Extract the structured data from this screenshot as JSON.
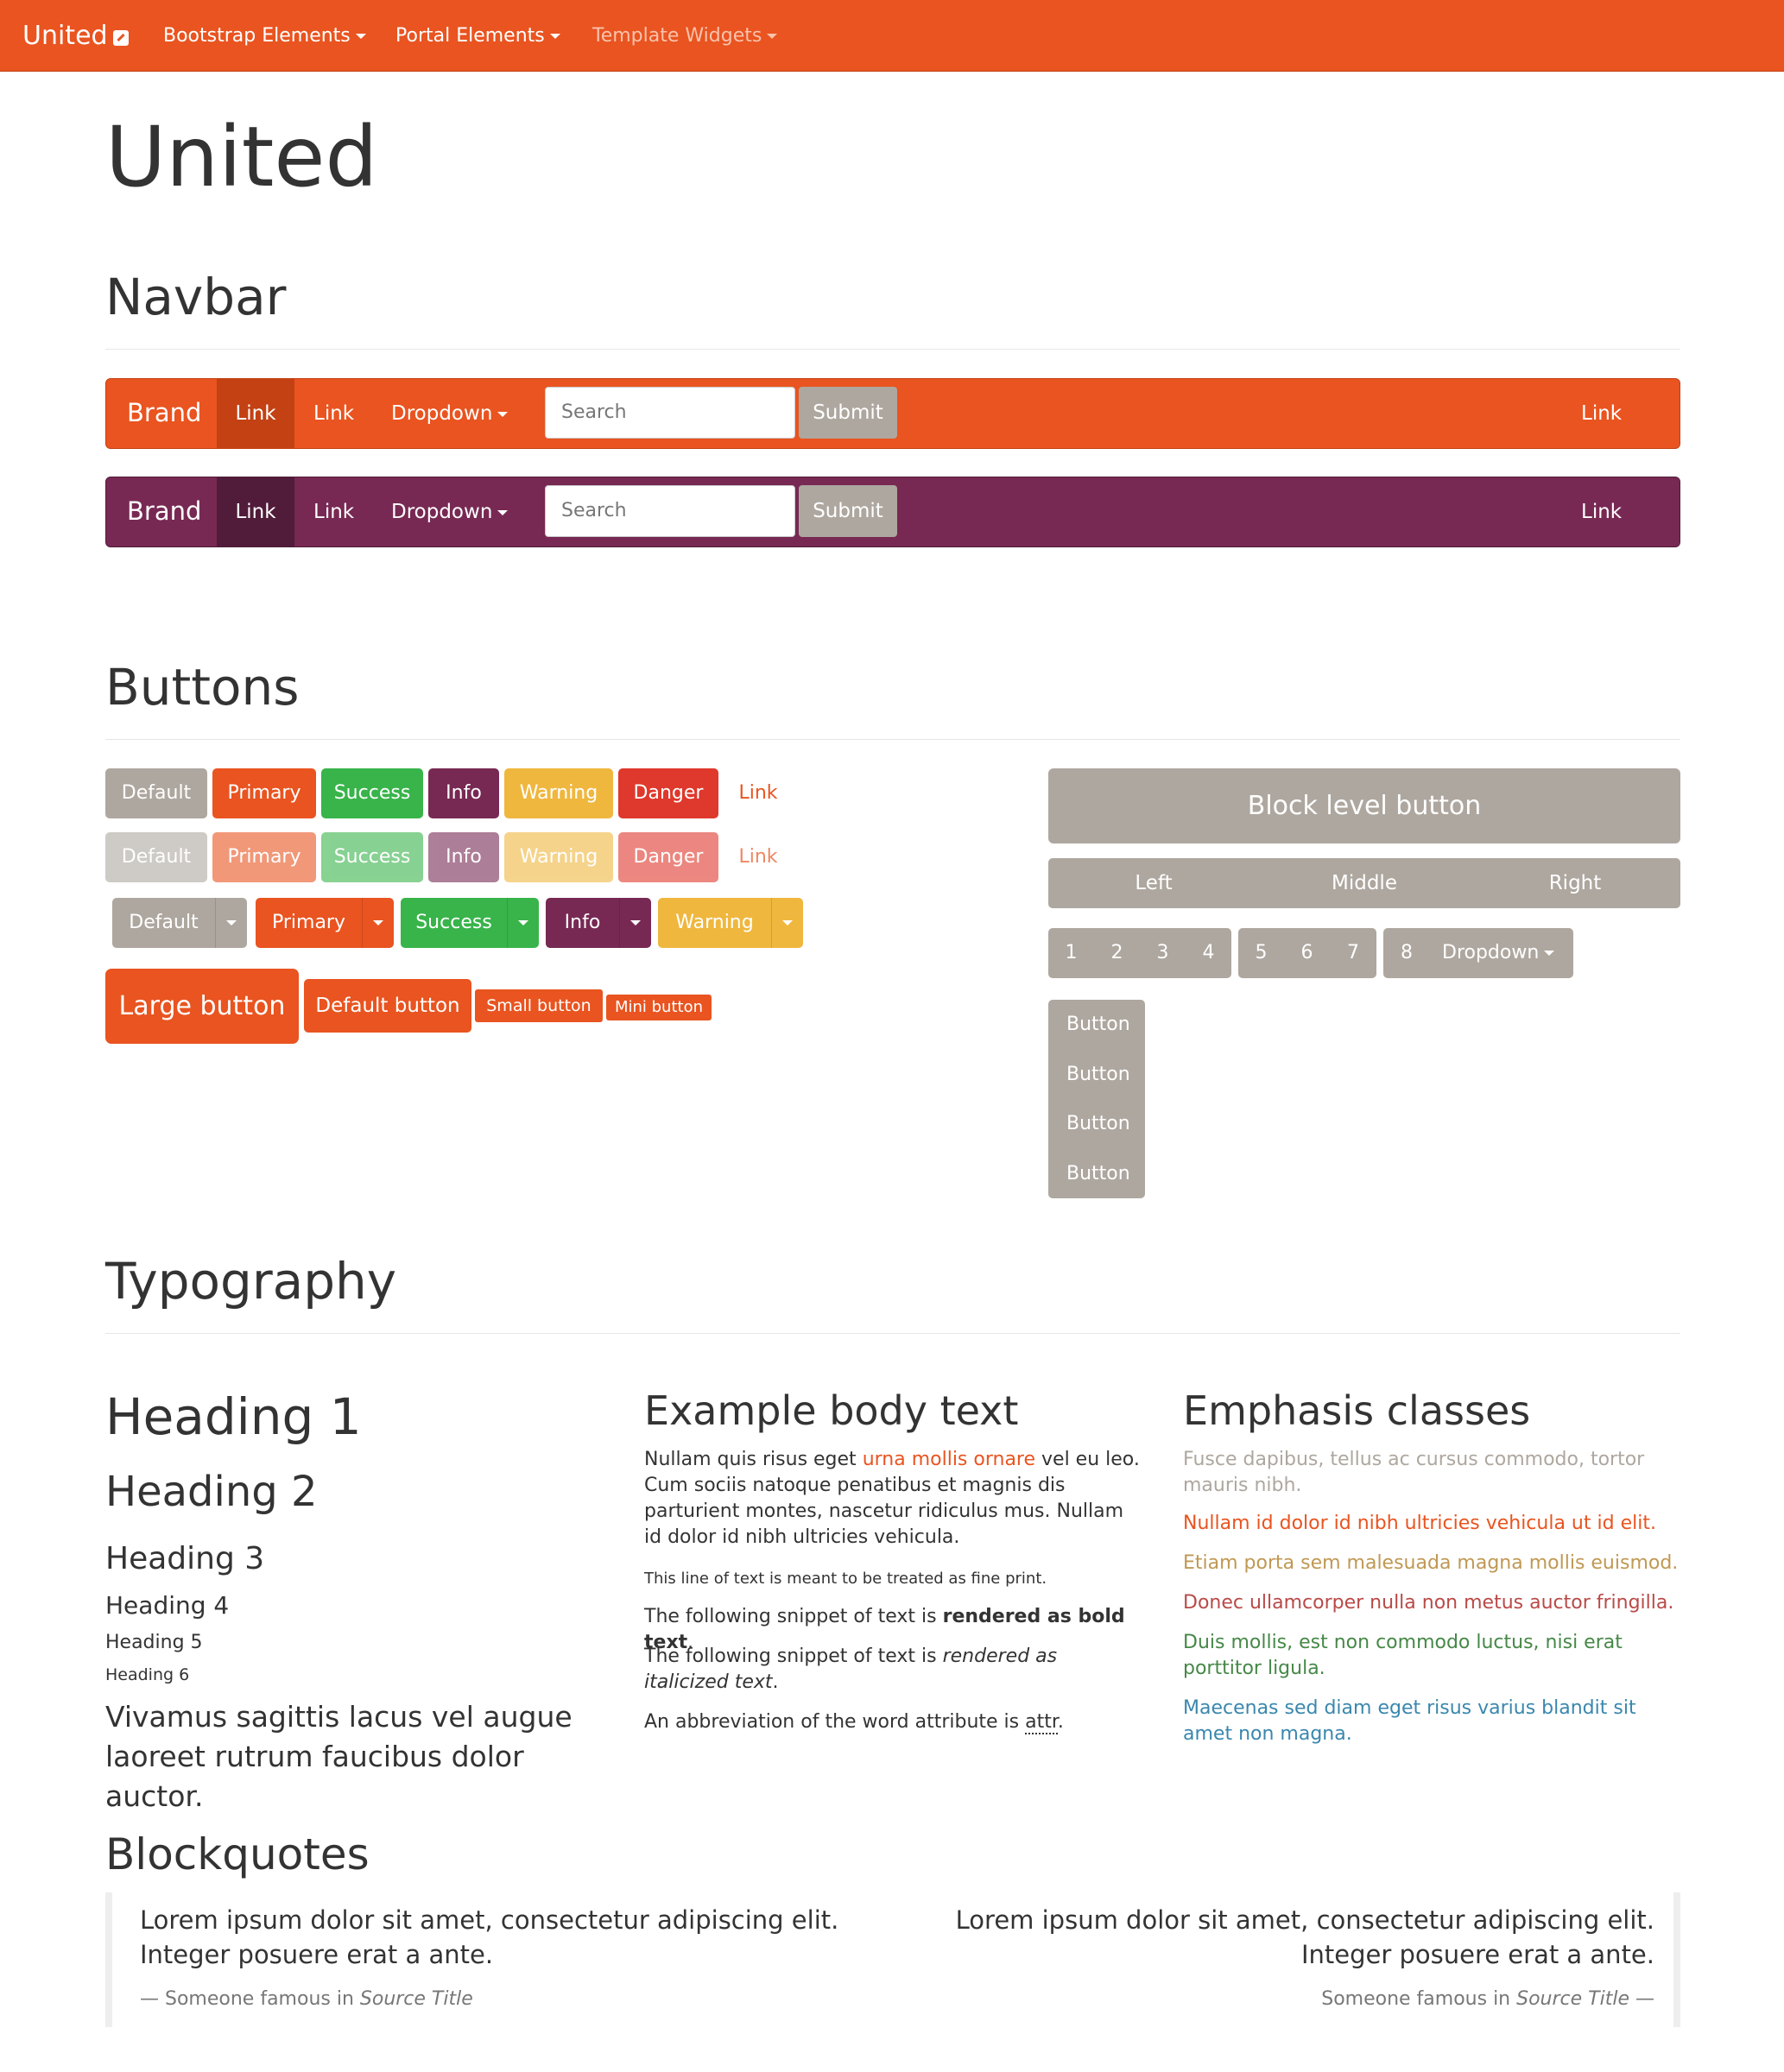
{
  "topbar": {
    "brand": "United",
    "items": [
      {
        "label": "Bootstrap Elements"
      },
      {
        "label": "Portal Elements"
      },
      {
        "label": "Template Widgets"
      }
    ]
  },
  "page_title": "United",
  "sections": {
    "navbar": "Navbar",
    "buttons": "Buttons",
    "typography": "Typography",
    "blockquotes": "Blockquotes"
  },
  "demo_navbars": [
    {
      "brand": "Brand",
      "active_link": "Link",
      "link": "Link",
      "dropdown": "Dropdown",
      "search_placeholder": "Search",
      "submit": "Submit",
      "right_link": "Link",
      "bg": "#e95420"
    },
    {
      "brand": "Brand",
      "active_link": "Link",
      "link": "Link",
      "dropdown": "Dropdown",
      "search_placeholder": "Search",
      "submit": "Submit",
      "right_link": "Link",
      "bg": "#772953"
    }
  ],
  "buttons": {
    "row1": [
      "Default",
      "Primary",
      "Success",
      "Info",
      "Warning",
      "Danger",
      "Link"
    ],
    "row2_disabled": [
      "Default",
      "Primary",
      "Success",
      "Info",
      "Warning",
      "Danger",
      "Link"
    ],
    "split": [
      "Default",
      "Primary",
      "Success",
      "Info",
      "Warning"
    ],
    "sizes": {
      "large": "Large button",
      "default": "Default button",
      "small": "Small button",
      "mini": "Mini button"
    },
    "block": "Block level button",
    "justified": [
      "Left",
      "Middle",
      "Right"
    ],
    "group1": [
      "1",
      "2",
      "3",
      "4"
    ],
    "group2": [
      "5",
      "6",
      "7"
    ],
    "group3": {
      "first": "8",
      "dropdown": "Dropdown"
    },
    "vertical": [
      "Button",
      "Button",
      "Button",
      "Button"
    ],
    "colors": {
      "default": "#aea79f",
      "primary": "#e95420",
      "success": "#38b44a",
      "info": "#772953",
      "warning": "#efb73e",
      "danger": "#df382c"
    }
  },
  "typography": {
    "headings": [
      "Heading 1",
      "Heading 2",
      "Heading 3",
      "Heading 4",
      "Heading 5",
      "Heading 6"
    ],
    "lead": "Vivamus sagittis lacus vel augue laoreet rutrum faucibus dolor auctor.",
    "body_title": "Example body text",
    "body_p1_before": "Nullam quis risus eget ",
    "body_p1_link": "urna mollis ornare",
    "body_p1_after": " vel eu leo. Cum sociis natoque penatibus et magnis dis parturient montes, nascetur ridiculus mus. Nullam id dolor id nibh ultricies vehicula.",
    "fine_print": "This line of text is meant to be treated as fine print.",
    "bold_before": "The following snippet of text is ",
    "bold_text": "rendered as bold text",
    "bold_after": ".",
    "italic_before": "The following snippet of text is ",
    "italic_text": "rendered as italicized text",
    "italic_after": ".",
    "abbr_before": "An abbreviation of the word attribute is ",
    "abbr_text": "attr",
    "abbr_after": ".",
    "emphasis_title": "Emphasis classes",
    "emphasis": [
      {
        "text": "Fusce dapibus, tellus ac cursus commodo, tortor mauris nibh.",
        "color": "#aea79f"
      },
      {
        "text": "Nullam id dolor id nibh ultricies vehicula ut id elit.",
        "color": "#e95420"
      },
      {
        "text": "Etiam porta sem malesuada magna mollis euismod.",
        "color": "#c09853"
      },
      {
        "text": "Donec ullamcorper nulla non metus auctor fringilla.",
        "color": "#b94a48"
      },
      {
        "text": "Duis mollis, est non commodo luctus, nisi erat porttitor ligula.",
        "color": "#468847"
      },
      {
        "text": "Maecenas sed diam eget risus varius blandit sit amet non magna.",
        "color": "#3a87ad"
      }
    ]
  },
  "blockquotes": [
    {
      "text": "Lorem ipsum dolor sit amet, consectetur adipiscing elit. Integer posuere erat a ante.",
      "dash": "—",
      "author": "Someone famous in ",
      "source": "Source Title"
    },
    {
      "text": "Lorem ipsum dolor sit amet, consectetur adipiscing elit. Integer posuere erat a ante.",
      "dash": "—",
      "author": "Someone famous in ",
      "source": "Source Title"
    }
  ]
}
